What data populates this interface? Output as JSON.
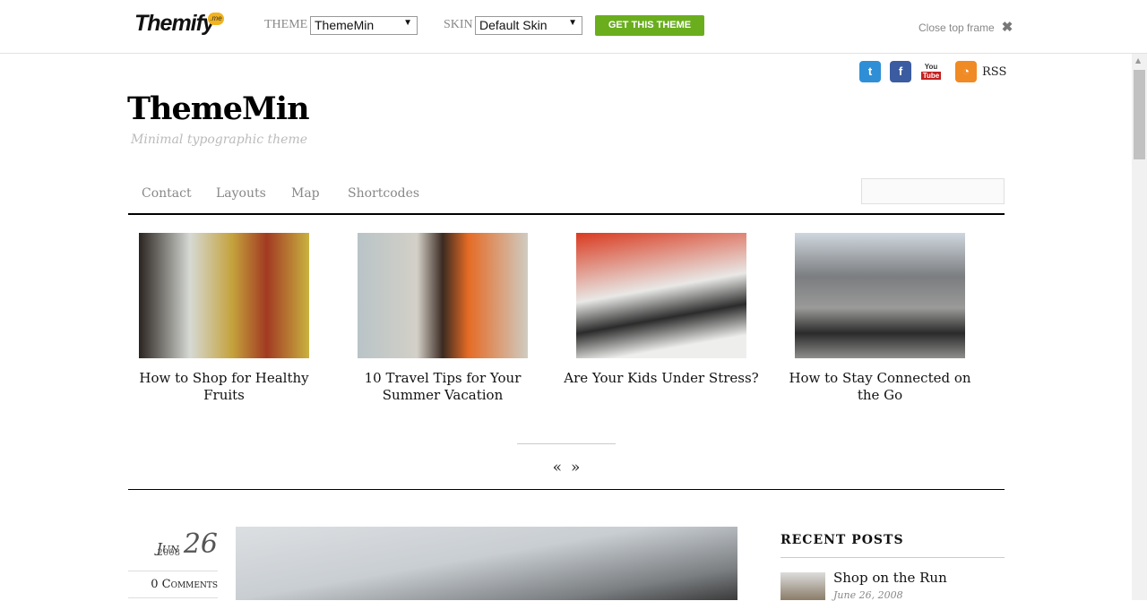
{
  "topframe": {
    "logo": "Themify",
    "logo_badge": ".me",
    "theme_label": "THEME",
    "theme_value": "ThemeMin",
    "skin_label": "SKIN",
    "skin_value": "Default Skin",
    "get_button": "GET THIS THEME",
    "close_label": "Close top frame",
    "close_icon": "x-icon"
  },
  "social": {
    "icons": [
      "twitter-icon",
      "facebook-icon",
      "youtube-icon",
      "rss-icon"
    ],
    "rss_label": "RSS"
  },
  "site": {
    "title": "ThemeMin",
    "tagline": "Minimal typographic theme"
  },
  "nav": {
    "items": [
      "Contact",
      "Layouts",
      "Map",
      "Shortcodes"
    ],
    "search_placeholder": ""
  },
  "slider": {
    "items": [
      {
        "caption": "How to Shop for Healthy Fruits"
      },
      {
        "caption": "10 Travel Tips for Your Summer Vacation"
      },
      {
        "caption": "Are Your Kids Under Stress?"
      },
      {
        "caption": "How to Stay Connected on the Go"
      }
    ],
    "prev": "«",
    "next": "»"
  },
  "post": {
    "month": "Jun",
    "day": "26",
    "year": "2008",
    "comments": "0 Comments"
  },
  "sidebar": {
    "heading": "RECENT POSTS",
    "posts": [
      {
        "title": "Shop on the Run",
        "date": "June 26, 2008"
      }
    ]
  },
  "colors": {
    "accent": "#6aae1e"
  }
}
